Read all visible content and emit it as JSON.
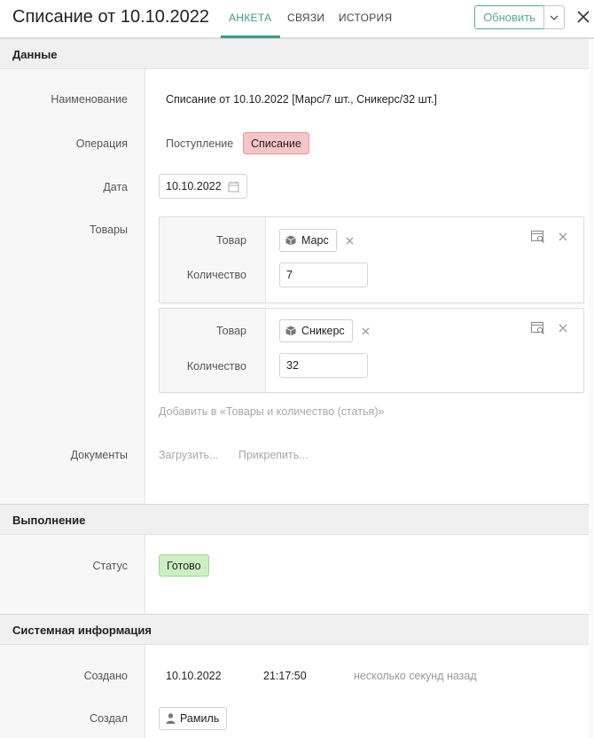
{
  "header": {
    "title": "Списание от 10.10.2022",
    "tabs": [
      {
        "label": "АНКЕТА",
        "active": true
      },
      {
        "label": "СВЯЗИ",
        "active": false
      },
      {
        "label": "ИСТОРИЯ",
        "active": false
      }
    ],
    "update_label": "Обновить",
    "accent_color": "#3f9b88"
  },
  "sections": {
    "data": "Данные",
    "execution": "Выполнение",
    "system": "Системная информация"
  },
  "fields": {
    "name_label": "Наименование",
    "name_value": "Списание от 10.10.2022 [Марс/7 шт., Сникерс/32 шт.]",
    "operation_label": "Операция",
    "operation_options": [
      "Поступление",
      "Списание"
    ],
    "operation_selected": "Списание",
    "date_label": "Дата",
    "date_value": "10.10.2022",
    "goods_label": "Товары",
    "goods": [
      {
        "product_label": "Товар",
        "product": "Марс",
        "qty_label": "Количество",
        "qty": "7"
      },
      {
        "product_label": "Товар",
        "product": "Сникерс",
        "qty_label": "Количество",
        "qty": "32"
      }
    ],
    "add_goods_link": "Добавить в «Товары и количество (статья)»",
    "documents_label": "Документы",
    "upload_link": "Загрузить...",
    "attach_link": "Прикрепить...",
    "status_label": "Статус",
    "status_value": "Готово",
    "created_label": "Создано",
    "created_date": "10.10.2022",
    "created_time": "21:17:50",
    "created_relative": "несколько секунд назад",
    "creator_label": "Создал",
    "creator_value": "Рамиль"
  },
  "colors": {
    "selected_operation_bg": "#f6c6c6",
    "status_ready_bg": "#cdefc4"
  }
}
